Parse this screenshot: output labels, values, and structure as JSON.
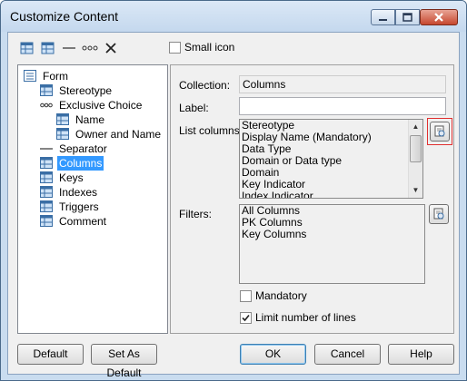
{
  "window": {
    "title": "Customize Content"
  },
  "toolbar": {
    "small_icon_label": "Small icon"
  },
  "tree": {
    "items": [
      {
        "label": "Form",
        "icon": "form-icon"
      },
      {
        "label": "Stereotype",
        "icon": "grid-icon"
      },
      {
        "label": "Exclusive Choice",
        "icon": "choice-icon"
      },
      {
        "label": "Name",
        "icon": "grid-icon"
      },
      {
        "label": "Owner and Name",
        "icon": "grid-icon"
      },
      {
        "label": "Separator",
        "icon": "separator-icon"
      },
      {
        "label": "Columns",
        "icon": "grid-icon"
      },
      {
        "label": "Keys",
        "icon": "grid-icon"
      },
      {
        "label": "Indexes",
        "icon": "grid-icon"
      },
      {
        "label": "Triggers",
        "icon": "grid-icon"
      },
      {
        "label": "Comment",
        "icon": "grid-icon"
      }
    ]
  },
  "details": {
    "collection_label": "Collection:",
    "collection_value": "Columns",
    "label_label": "Label:",
    "label_value": "",
    "list_columns_label": "List columns:",
    "list_columns": [
      "Stereotype",
      "Display Name (Mandatory)",
      "Data Type",
      "Domain or Data type",
      "Domain",
      "Key Indicator",
      "Index Indicator"
    ],
    "filters_label": "Filters:",
    "filters": [
      "All Columns",
      "PK Columns",
      "Key Columns"
    ],
    "mandatory_label": "Mandatory",
    "mandatory_checked": false,
    "limit_label": "Limit number of lines",
    "limit_checked": true
  },
  "buttons": {
    "default": "Default",
    "set_as_default": "Set As Default",
    "ok": "OK",
    "cancel": "Cancel",
    "help": "Help"
  },
  "colors": {
    "selection": "#3399ff",
    "highlight_border": "#e03030"
  }
}
